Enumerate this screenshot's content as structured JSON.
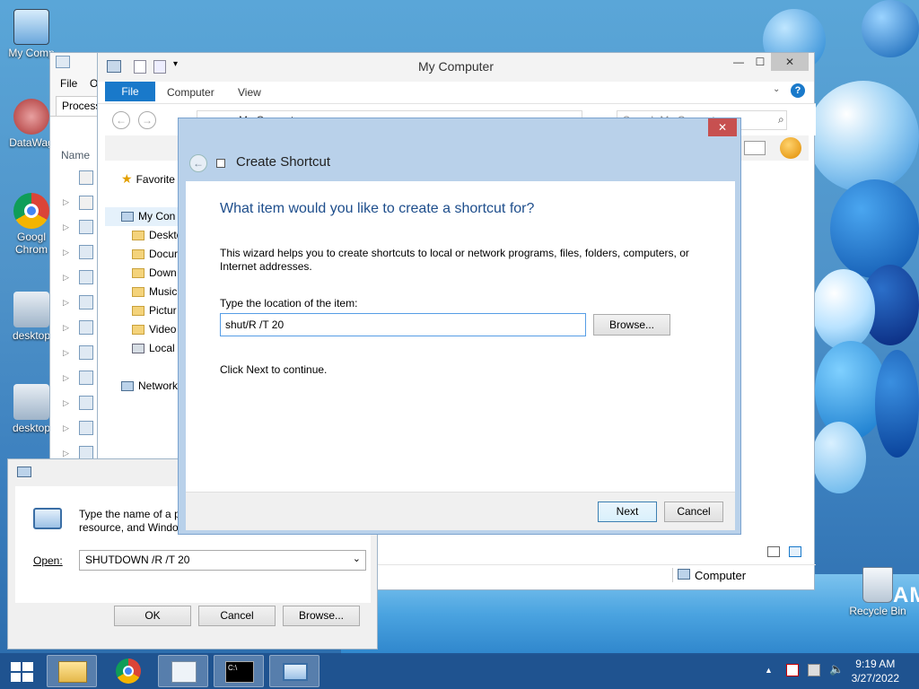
{
  "desktop": {
    "icons": [
      {
        "label": "My Comp"
      },
      {
        "label": "DataWag"
      },
      {
        "label": "Googl Chrom"
      },
      {
        "label": "desktop"
      },
      {
        "label": "desktop"
      },
      {
        "label": "Recycle Bin"
      }
    ],
    "brand_text": "SAM"
  },
  "task_manager": {
    "menu_file": "File",
    "menu_o": "O",
    "tab_processes": "Process",
    "col_name": "Name"
  },
  "explorer": {
    "title": "My Computer",
    "ribbon_tabs": [
      "File",
      "Computer",
      "View"
    ],
    "address": "My Computer",
    "search_placeholder": "Search My Computer",
    "nav": {
      "favorites": "Favorite",
      "my_computer": "My Con",
      "items": [
        "Deskto",
        "Docur",
        "Down",
        "Music",
        "Pictur",
        "Video",
        "Local"
      ],
      "network": "Network"
    },
    "status_computer": "Computer"
  },
  "run_dialog": {
    "description_line1": "Type the name of a pro",
    "description_line2": "resource, and Window",
    "open_label": "Open:",
    "open_value": "SHUTDOWN /R  /T 20",
    "ok": "OK",
    "cancel": "Cancel",
    "browse": "Browse..."
  },
  "wizard": {
    "title": "Create Shortcut",
    "heading": "What item would you like to create a shortcut for?",
    "description": "This wizard helps you to create shortcuts to local or network programs, files, folders, computers, or Internet addresses.",
    "location_label": "Type the location of the item:",
    "location_value": "shut/R  /T 20",
    "browse": "Browse...",
    "hint": "Click Next to continue.",
    "next": "Next",
    "cancel": "Cancel",
    "close_glyph": "✕"
  },
  "taskbar": {
    "time": "9:19 AM",
    "date": "3/27/2022",
    "items": [
      "start-button",
      "file-explorer",
      "chrome",
      "task-manager",
      "command-prompt",
      "run-dialog"
    ]
  },
  "colors": {
    "wizard_heading": "#1e4e8c",
    "close_red": "#c75050",
    "accent_blue": "#1979ca"
  }
}
